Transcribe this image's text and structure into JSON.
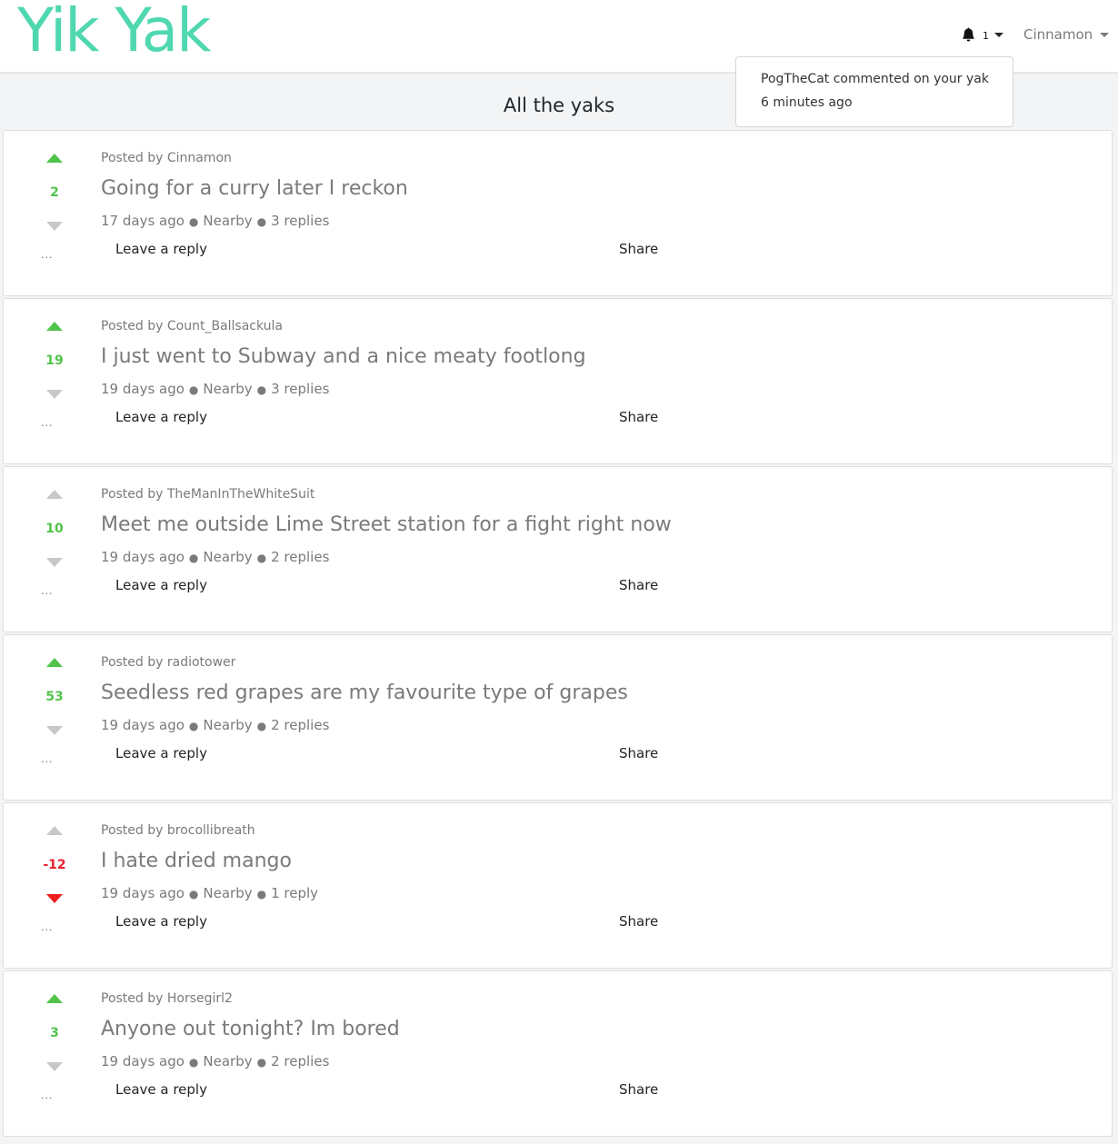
{
  "brand": {
    "logo_text": "Yik Yak",
    "logo_color": "#4fd8b0"
  },
  "header": {
    "notification_count": "1",
    "username": "Cinnamon"
  },
  "notification": {
    "text": "PogTheCat commented on your yak",
    "time": "6 minutes ago"
  },
  "page_title": "All the yaks",
  "colors": {
    "upvote_active": "#52c34a",
    "downvote_active": "#ef1c1c",
    "vote_inactive": "#c8c8c8"
  },
  "yaks": [
    {
      "posted_by": "Posted by Cinnamon",
      "text": "Going for a curry later I reckon",
      "score": "2",
      "vote": "up",
      "age": "17 days ago",
      "location": "Nearby",
      "replies": "3 replies",
      "reply_label": "Leave a reply",
      "share_label": "Share",
      "more_label": "..."
    },
    {
      "posted_by": "Posted by Count_Ballsackula",
      "text": "I just went to Subway and a nice meaty footlong",
      "score": "19",
      "vote": "up",
      "age": "19 days ago",
      "location": "Nearby",
      "replies": "3 replies",
      "reply_label": "Leave a reply",
      "share_label": "Share",
      "more_label": "..."
    },
    {
      "posted_by": "Posted by TheManInTheWhiteSuit",
      "text": "Meet me outside Lime Street station for a fight right now",
      "score": "10",
      "vote": "none",
      "age": "19 days ago",
      "location": "Nearby",
      "replies": "2 replies",
      "reply_label": "Leave a reply",
      "share_label": "Share",
      "more_label": "..."
    },
    {
      "posted_by": "Posted by radiotower",
      "text": "Seedless red grapes are my favourite type of grapes",
      "score": "53",
      "vote": "up",
      "age": "19 days ago",
      "location": "Nearby",
      "replies": "2 replies",
      "reply_label": "Leave a reply",
      "share_label": "Share",
      "more_label": "..."
    },
    {
      "posted_by": "Posted by brocollibreath",
      "text": "I hate dried mango",
      "score": "-12",
      "vote": "down",
      "age": "19 days ago",
      "location": "Nearby",
      "replies": "1 reply",
      "reply_label": "Leave a reply",
      "share_label": "Share",
      "more_label": "..."
    },
    {
      "posted_by": "Posted by Horsegirl2",
      "text": "Anyone out tonight? Im bored",
      "score": "3",
      "vote": "up",
      "age": "19 days ago",
      "location": "Nearby",
      "replies": "2 replies",
      "reply_label": "Leave a reply",
      "share_label": "Share",
      "more_label": "..."
    }
  ]
}
